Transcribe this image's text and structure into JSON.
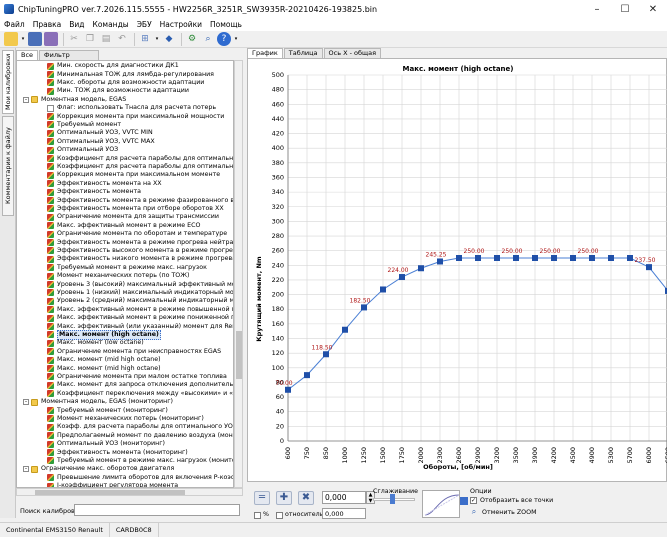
{
  "window": {
    "title": "ChipTuningPRO ver.7.2026.115.5555 - HW2256R_3251R_SW3935R-20210426-193825.bin",
    "minimize": "–",
    "maximize": "☐",
    "close": "✕"
  },
  "menu": [
    "Файл",
    "Правка",
    "Вид",
    "Команды",
    "ЭБУ",
    "Настройки",
    "Помощь"
  ],
  "left_panel": {
    "vertical_tabs": [
      "Мои калибровки",
      "Комментарии к файлу"
    ],
    "filter_tabs": [
      "Все",
      "Фильтр"
    ],
    "search_label": "Поиск калибровки"
  },
  "tree": [
    {
      "label": "Мин. скорость для диагностики ДК1",
      "level": 2,
      "icon": "map"
    },
    {
      "label": "Минимальная ТОЖ для лямбда-регулирования",
      "level": 2,
      "icon": "map"
    },
    {
      "label": "Макс. обороты для возможности адаптации",
      "level": 2,
      "icon": "map"
    },
    {
      "label": "Мин. ТОЖ для возможности адаптации",
      "level": 2,
      "icon": "map"
    },
    {
      "label": "Моментная модель, EGAS",
      "level": 1,
      "icon": "folder",
      "expander": "–"
    },
    {
      "label": "Флаг: использовать Тнасла для расчета потерь",
      "level": 2,
      "icon": "flag"
    },
    {
      "label": "Коррекция момента при максимальной мощности",
      "level": 2,
      "icon": "map"
    },
    {
      "label": "Требуемый момент",
      "level": 2,
      "icon": "map"
    },
    {
      "label": "Оптимальный УОЗ, VVTC MIN",
      "level": 2,
      "icon": "map"
    },
    {
      "label": "Оптимальный УОЗ, VVTC MAX",
      "level": 2,
      "icon": "map"
    },
    {
      "label": "Оптимальный УОЗ",
      "level": 2,
      "icon": "map"
    },
    {
      "label": "Коэффициент для расчета параболы для оптимального",
      "level": 2,
      "icon": "map"
    },
    {
      "label": "Коэффициент для расчета параболы для оптимального",
      "level": 2,
      "icon": "map"
    },
    {
      "label": "Коррекция момента при максимальном моменте",
      "level": 2,
      "icon": "map"
    },
    {
      "label": "Эффективность момента на ХХ",
      "level": 2,
      "icon": "map"
    },
    {
      "label": "Эффективность момента",
      "level": 2,
      "icon": "map"
    },
    {
      "label": "Эффективность момента в режиме фазированного впры",
      "level": 2,
      "icon": "map"
    },
    {
      "label": "Эффективность момента при отборе оборотов ХХ",
      "level": 2,
      "icon": "map"
    },
    {
      "label": "Ограничение момента для защиты трансмиссии",
      "level": 2,
      "icon": "map"
    },
    {
      "label": "Макс. эффективный момент в режиме ECO",
      "level": 2,
      "icon": "map"
    },
    {
      "label": "Ограничение момента по оборотам и температуре",
      "level": 2,
      "icon": "map"
    },
    {
      "label": "Эффективность момента в режиме прогрева нейтрализ",
      "level": 2,
      "icon": "map"
    },
    {
      "label": "Эффективность высокого момента в режиме прогрева н",
      "level": 2,
      "icon": "map"
    },
    {
      "label": "Эффективность низкого момента в режиме прогрева не",
      "level": 2,
      "icon": "map"
    },
    {
      "label": "Требуемый момент в режиме макс. нагрузок",
      "level": 2,
      "icon": "map"
    },
    {
      "label": "Момент механических потерь (по ТОЖ)",
      "level": 2,
      "icon": "map"
    },
    {
      "label": "Уровень 3 (высокий) максимальный эффективный моме",
      "level": 2,
      "icon": "map"
    },
    {
      "label": "Уровень 1 (низкий) максимальный индикаторный момент",
      "level": 2,
      "icon": "map"
    },
    {
      "label": "Уровень 2 (средний) максимальный индикаторный моме",
      "level": 2,
      "icon": "map"
    },
    {
      "label": "Макс. эффективный момент в режиме повышенной перед",
      "level": 2,
      "icon": "map"
    },
    {
      "label": "Макс. эффективный момент в режиме пониженной перед",
      "level": 2,
      "icon": "map"
    },
    {
      "label": "Макс. эффективный (или указанный) момент для Renault",
      "level": 2,
      "icon": "map"
    },
    {
      "label": "Макс. момент (high octane)",
      "level": 2,
      "icon": "map",
      "selected": true
    },
    {
      "label": "Макс. момент (low octane)",
      "level": 2,
      "icon": "map"
    },
    {
      "label": "Ограничение момента при неисправностях EGAS",
      "level": 2,
      "icon": "map"
    },
    {
      "label": "Макс. момент (mid high octane)",
      "level": 2,
      "icon": "map"
    },
    {
      "label": "Макс. момент (mid high octane)",
      "level": 2,
      "icon": "map"
    },
    {
      "label": "Ограничение момента при малом остатке топлива",
      "level": 2,
      "icon": "map"
    },
    {
      "label": "Макс. момент для запроса отключения дополнительных",
      "level": 2,
      "icon": "map"
    },
    {
      "label": "Коэффициент переключения между «высокими» и «низ",
      "level": 2,
      "icon": "map"
    },
    {
      "label": "Моментная модель, EGAS (мониторинг)",
      "level": 1,
      "icon": "folder",
      "expander": "–"
    },
    {
      "label": "Требуемый момент (мониторинг)",
      "level": 2,
      "icon": "map"
    },
    {
      "label": "Момент механических потерь (мониторинг)",
      "level": 2,
      "icon": "map"
    },
    {
      "label": "Коэфф. для расчета параболы для оптимального УОЗ (м",
      "level": 2,
      "icon": "map"
    },
    {
      "label": "Предполагаемый момент по давлению воздуха (монитор",
      "level": 2,
      "icon": "map"
    },
    {
      "label": "Оптимальный УОЗ (мониторинг)",
      "level": 2,
      "icon": "map"
    },
    {
      "label": "Эффективность момента (мониторинг)",
      "level": 2,
      "icon": "map"
    },
    {
      "label": "Требуемый момент в режиме макс. нагрузок (монитори",
      "level": 2,
      "icon": "map"
    },
    {
      "label": "Ограничение макс. оборотов двигателя",
      "level": 1,
      "icon": "folder",
      "expander": "–"
    },
    {
      "label": "Превышение лимита оборотов для включения P-коэфф.",
      "level": 2,
      "icon": "map"
    },
    {
      "label": "I-коэффициент регулятора момента",
      "level": 2,
      "icon": "map"
    },
    {
      "label": "P-коэффициент регулятора момента",
      "level": 2,
      "icon": "map"
    }
  ],
  "right_panel": {
    "tabs": [
      "График",
      "Таблица",
      "Ось X - общая"
    ]
  },
  "chart_data": {
    "type": "line",
    "title": "Макс. момент (high octane)",
    "xlabel": "Обороты, [об/мин]",
    "ylabel": "Крутящий момент, Nm",
    "ylim": [
      0,
      500
    ],
    "yticks": [
      0,
      20,
      40,
      60,
      80,
      100,
      120,
      140,
      160,
      180,
      200,
      220,
      240,
      260,
      280,
      300,
      320,
      340,
      360,
      380,
      400,
      420,
      440,
      460,
      480,
      500
    ],
    "categories": [
      "600",
      "750",
      "850",
      "1000",
      "1250",
      "1500",
      "1750",
      "2000",
      "2300",
      "2600",
      "2900",
      "3200",
      "3500",
      "3900",
      "4200",
      "4500",
      "4900",
      "5300",
      "5700",
      "6000",
      "6500"
    ],
    "values": [
      70,
      90,
      118.5,
      152,
      182.5,
      207,
      224,
      236,
      245.25,
      250,
      250,
      250,
      250,
      250,
      250,
      250,
      250,
      250,
      250,
      237.5,
      205
    ],
    "point_labels": [
      "70.00",
      "",
      "118.50",
      "",
      "182.50",
      "",
      "224.00",
      "",
      "245.25",
      "",
      "250.00",
      "",
      "250.00",
      "",
      "250.00",
      "",
      "250.00",
      "",
      "",
      "237.50",
      ""
    ],
    "grid": true,
    "line_color": "#4a7fd4",
    "marker_color": "#1f4fa8",
    "label_color": "#b01818"
  },
  "controls": {
    "spin_value": "0,000",
    "smoothing_label": "Сглаживание",
    "percent_label": "%",
    "relative_label": "относительно",
    "relative_value": "0,000",
    "options_label": "Опции",
    "show_all_points_label": "Отобразить все точки",
    "cancel_zoom_label": "Отменить ZOOM"
  },
  "status": {
    "ecu": "Continental EMS3150 Renault",
    "file": "CARDB0C8"
  }
}
